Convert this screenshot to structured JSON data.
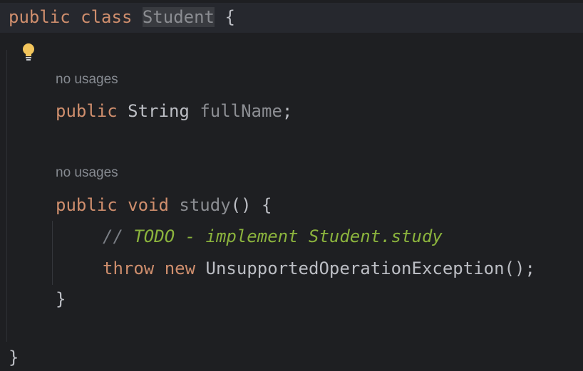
{
  "code": {
    "l1": {
      "kw1": "public",
      "kw2": "class",
      "name": "Student",
      "brace": "{"
    },
    "hint1": "no usages",
    "l2": {
      "kw": "public",
      "type": "String",
      "field": "fullName",
      "semi": ";"
    },
    "hint2": "no usages",
    "l3": {
      "kw1": "public",
      "kw2": "void",
      "fn": "study",
      "parens": "()",
      "brace": "{"
    },
    "l4": {
      "slashes": "//",
      "todo": "TODO - implement Student.study"
    },
    "l5": {
      "kw1": "throw",
      "kw2": "new",
      "rest": "UnsupportedOperationException();"
    },
    "l6": {
      "brace": "}"
    },
    "l7": {
      "brace": "}"
    }
  },
  "icons": {
    "intention": "lightbulb-icon"
  },
  "colors": {
    "background": "#1e1f22",
    "keyword": "#cf8e6d",
    "todo_comment": "#8bb33d",
    "field_name": "#8b8d92",
    "bulb": "#f2c55c"
  }
}
